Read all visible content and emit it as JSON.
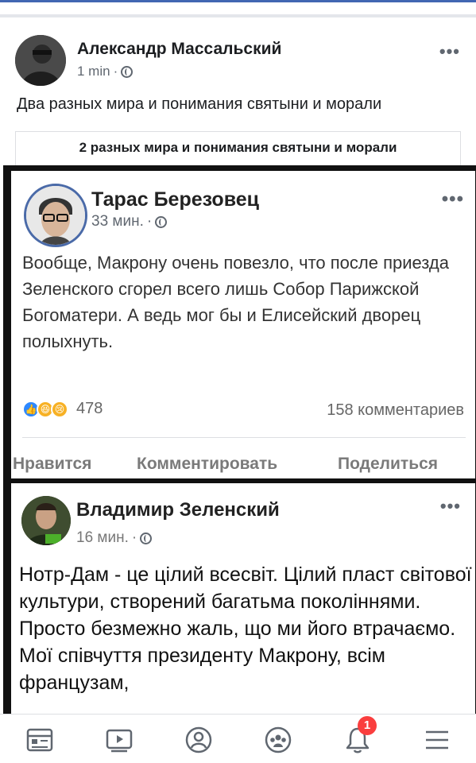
{
  "post": {
    "author": "Александр Массальский",
    "time": "1 min",
    "text": "Два разных мира и понимания святыни и морали",
    "link_caption": "2 разных мира и понимания святыни и морали"
  },
  "screenshot": {
    "post1": {
      "author": "Тарас Березовец",
      "time": "33 мин.",
      "text": "Вообще, Макрону очень повезло, что после приезда Зеленского сгорел всего лишь Собор Парижской Богоматери. А ведь мог бы и Елисейский дворец полыхнуть.",
      "reaction_count": "478",
      "comments": "158 комментариев",
      "actions": {
        "like": "Нравится",
        "comment": "Комментировать",
        "share": "Поделиться"
      }
    },
    "post2": {
      "author": "Владимир Зеленский",
      "time": "16 мин.",
      "text": "Нотр-Дам - це цілий всесвіт. Цілий пласт світової культури, створений багатьма поколіннями. Просто безмежно жаль, що ми його втрачаємо. Мої співчуття президенту Макрону, всім французам,"
    }
  },
  "nav": {
    "items": [
      {
        "icon": "news-feed-icon"
      },
      {
        "icon": "watch-icon"
      },
      {
        "icon": "profile-icon"
      },
      {
        "icon": "groups-icon"
      },
      {
        "icon": "notifications-icon",
        "badge": "1"
      },
      {
        "icon": "menu-icon"
      }
    ],
    "accent": "#fa3e3e"
  },
  "colors": {
    "brand": "#4267b2",
    "text": "#1c1e21",
    "secondary": "#606770"
  }
}
